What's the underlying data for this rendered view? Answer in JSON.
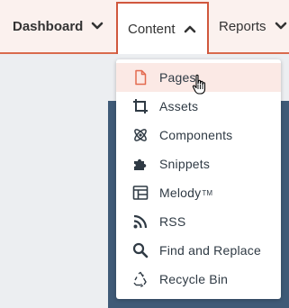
{
  "nav": {
    "dashboard_label": "Dashboard",
    "content_label": "Content",
    "reports_label": "Reports"
  },
  "menu": {
    "items": [
      {
        "label": "Pages",
        "icon": "file-icon"
      },
      {
        "label": "Assets",
        "icon": "crop-icon"
      },
      {
        "label": "Components",
        "icon": "atom-icon"
      },
      {
        "label": "Snippets",
        "icon": "puzzle-icon"
      },
      {
        "label": "Melody",
        "icon": "layout-icon",
        "superscript": "TM"
      },
      {
        "label": "RSS",
        "icon": "rss-icon"
      },
      {
        "label": "Find and Replace",
        "icon": "search-icon"
      },
      {
        "label": "Recycle Bin",
        "icon": "recycle-icon"
      }
    ]
  },
  "colors": {
    "accent": "#d0573d",
    "navbar_bg": "#fbf1ee",
    "active_item_bg": "#fbe9e5",
    "panel_bg": "#3f5a77"
  }
}
